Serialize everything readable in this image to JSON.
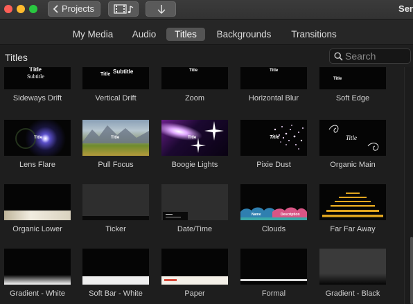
{
  "window": {
    "title": "Ser"
  },
  "toolbar": {
    "projects_label": "Projects"
  },
  "tabs": [
    {
      "label": "My Media"
    },
    {
      "label": "Audio"
    },
    {
      "label": "Titles"
    },
    {
      "label": "Backgrounds"
    },
    {
      "label": "Transitions"
    }
  ],
  "section": {
    "title": "Titles"
  },
  "search": {
    "placeholder": "Search",
    "value": ""
  },
  "tiles": [
    {
      "label": "Sideways Drift"
    },
    {
      "label": "Vertical Drift"
    },
    {
      "label": "Zoom"
    },
    {
      "label": "Horizontal Blur"
    },
    {
      "label": "Soft Edge"
    },
    {
      "label": "Lens Flare"
    },
    {
      "label": "Pull Focus"
    },
    {
      "label": "Boogie Lights"
    },
    {
      "label": "Pixie Dust"
    },
    {
      "label": "Organic Main"
    },
    {
      "label": "Organic Lower"
    },
    {
      "label": "Ticker"
    },
    {
      "label": "Date/Time"
    },
    {
      "label": "Clouds"
    },
    {
      "label": "Far Far Away"
    },
    {
      "label": "Gradient - White"
    },
    {
      "label": "Soft Bar - White"
    },
    {
      "label": "Paper"
    },
    {
      "label": "Formal"
    },
    {
      "label": "Gradient - Black"
    }
  ],
  "thumb_text": {
    "sideways_drift": [
      "Title",
      "Subtitle"
    ],
    "vertical_drift": [
      "Title",
      "Subtitle"
    ],
    "zoom": [
      "Title"
    ],
    "horizontal_blur": [
      "Title"
    ],
    "soft_edge": [
      "Title"
    ],
    "lens_flare": [
      "Title"
    ],
    "pull_focus": [
      "Title"
    ],
    "boogie_lights": [
      "Title"
    ],
    "pixie_dust": [
      "Title"
    ],
    "organic_main": [
      "Title"
    ],
    "clouds": [
      "Name",
      "Description"
    ]
  },
  "colors": {
    "accent_active_tab": "#545454",
    "close": "#fd5f57",
    "minimize": "#febb2e",
    "zoom": "#29c840"
  }
}
